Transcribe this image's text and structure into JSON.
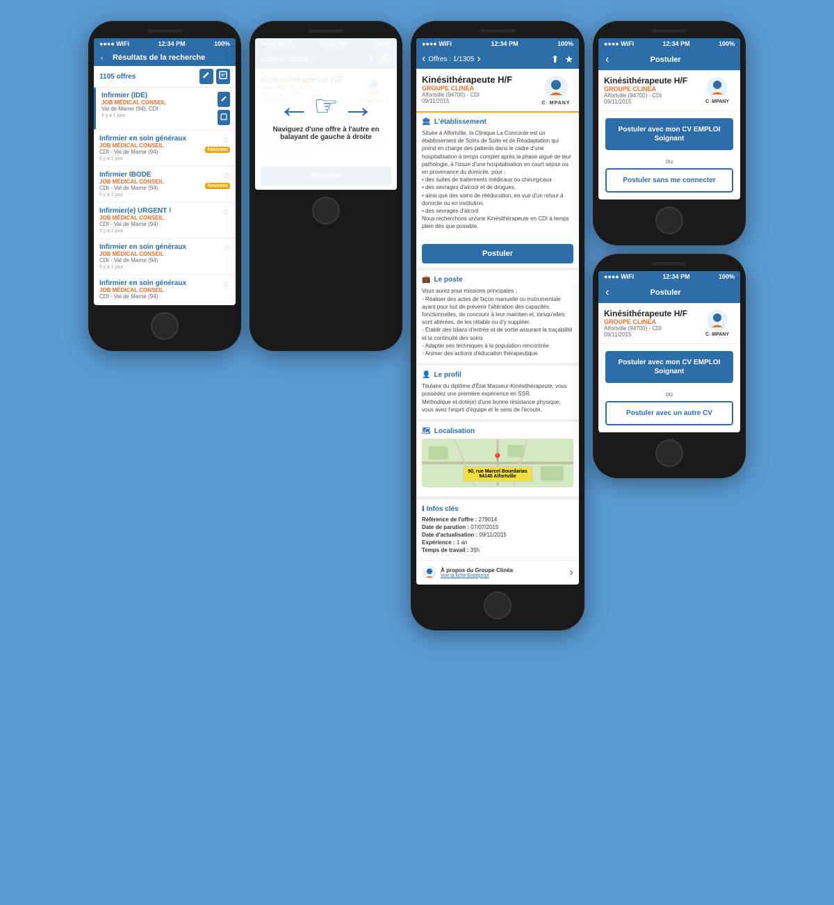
{
  "screen1": {
    "status": {
      "time": "12:34 PM",
      "signal": "●●●●",
      "wifi": "WiFi",
      "battery": "100%"
    },
    "nav": {
      "title": "Résultats de la recherche",
      "back": "‹"
    },
    "count": "1105 offres",
    "results": [
      {
        "title": "Infirmier (IDE)",
        "company": "JOB MÉDICAL CONSEIL",
        "location": "Val de Marne (94), CDI",
        "date": "Il y a 1 jour",
        "badge": "",
        "active": true
      },
      {
        "title": "Infirmier en soin généraux",
        "company": "JOB MÉDICAL CONSEIL",
        "location": "CDI - Val de Marne (94)",
        "date": "Il y a 1 jour",
        "badge": "Nouveau",
        "active": false
      },
      {
        "title": "Infirmier IBODE",
        "company": "JOB MÉDICAL CONSEIL",
        "location": "CDI - Val de Marne (94)",
        "date": "Il y a 1 jour",
        "badge": "Nouveau",
        "active": false
      },
      {
        "title": "Infirmier(e) URGENT !",
        "company": "JOB MÉDICAL CONSEIL",
        "location": "CDI - Val de Marne (94)",
        "date": "Il y a 1 jour",
        "badge": "",
        "active": false
      },
      {
        "title": "Infirmier en soin généraux",
        "company": "JOB MÉDICAL CONSEIL",
        "location": "CDI - Val de Marne (94)",
        "date": "Il y a 1 jour",
        "badge": "",
        "active": false
      },
      {
        "title": "Infirmier en soin généraux",
        "company": "JOB MÉDICAL CONSEIL",
        "location": "CDI - Val de Marne (94)",
        "date": "",
        "badge": "",
        "active": false
      }
    ]
  },
  "screen2": {
    "status": {
      "time": "12:34 PM",
      "signal": "●●●●",
      "wifi": "WiFi",
      "battery": "100%"
    },
    "nav": {
      "back": "‹ Offres :",
      "counter": "1/1305",
      "forward": "›",
      "share": "⬆",
      "close": "✕"
    },
    "offer": {
      "title": "Kinésithérapeute H/F",
      "company": "GROUPE CLINÉA",
      "location": "Alfortville (94700) - CDI",
      "date": "09/11/2015",
      "company_logo": "COMPANY"
    },
    "swipe_text": "Naviguez d'une offre à l'autre en balayant de gauche à droite",
    "postuler": "Postuler"
  },
  "screen3": {
    "status": {
      "time": "12:34 PM",
      "signal": "●●●●",
      "wifi": "WiFi",
      "battery": "100%"
    },
    "nav": {
      "back": "‹",
      "counter": "Offres : 1/1305",
      "forward": "›",
      "share": "⬆",
      "star": "★"
    },
    "offer": {
      "title": "Kinésithérapeute H/F",
      "company": "GROUPE CLINÉA",
      "location": "Alfortville (94700) - CDI",
      "date": "09/11/2015",
      "company_logo": "COMPANY"
    },
    "sections": {
      "etablissement": {
        "title": "L'établissement",
        "text": "Située à Alfortville, la Clinique La Concorde est un établissement de Soins de Suite et de Réadaptation qui prend en charge des patients dans le cadre d'une hospitalisation à temps complet après la phase aiguë de leur pathologie, à l'issue d'une hospitalisation en court séjour ou en provenance du domicile, pour :\n• des suites de traitements médicaux ou chirurgicaux\n• des sevrages d'alcool et de drogues,\n• ainsi que des soins de rééducation, en vue d'un retour à domicile ou en institution,\n• des sevrages d'alcool\nNous recherchons un/une Kinésithérapeute en CDI à temps plein dès que possible."
      },
      "poste": {
        "title": "Le poste",
        "text": "Vous aurez pour missions principales :\n- Réaliser des actes de façon manuelle ou instrumentale ayant pour but de prévenir l'altération des capacités fonctionnelles, de concourir à leur maintien et, lorsqu'elles sont altérées, de les rétablir ou d'y suppléer.\n- Établir des bilans d'entrée et de sortie assurant la traçabilité et la continuité des soins\n- Adapter ses techniques à la population rencontrée\n- Animer des actions d'éducation thérapeutique"
      },
      "profil": {
        "title": "Le profil",
        "text": "Titulaire du diplôme d'État Masseur-Kinésithérapeute, vous possédez une première expérience en SSR.\nMéthodique et doté(e) d'une bonne résistance physique, vous avez l'esprit d'équipe et le sens de l'écoute."
      },
      "localisation": {
        "title": "Localisation",
        "address": "90, rue Marcel Bourdarias",
        "city": "94140 Alfortville"
      },
      "infos": {
        "title": "Infos clés",
        "reference": "279014",
        "date_parution": "07/07/2015",
        "date_actualisation": "09/11/2015",
        "experience": "1 an",
        "temps_travail": "35h"
      }
    },
    "company_footer": {
      "title": "À propos du Groupe Clinéa",
      "link": "Voir la fiche Entreprise"
    },
    "postuler": "Postuler"
  },
  "screen4": {
    "status": {
      "time": "12:34 PM",
      "signal": "●●●●",
      "wifi": "WiFi",
      "battery": "100%"
    },
    "nav": {
      "back": "‹",
      "title": "Postuler"
    },
    "offer": {
      "title": "Kinésithérapeute H/F",
      "company": "GROUPE CLINÉA",
      "location": "Alfortville (94700) - CDI",
      "date": "09/11/2015",
      "company_logo": "COMPANY"
    },
    "btn_primary": "Postuler avec mon CV EMPLOI Soignant",
    "separator": "ou",
    "btn_secondary": "Postuler sans me connecter"
  },
  "screen5": {
    "status": {
      "time": "12:34 PM",
      "signal": "●●●●",
      "wifi": "WiFi",
      "battery": "100%"
    },
    "nav": {
      "back": "‹",
      "title": "Postuler"
    },
    "offer": {
      "title": "Kinésithérapeute H/F",
      "company": "GROUPE CLINÉA",
      "location": "Alfortville (94700) - CDI",
      "date": "09/11/2015",
      "company_logo": "COMPANY"
    },
    "btn_primary": "Postuler avec mon CV EMPLOI Soignant",
    "separator": "ou",
    "btn_secondary": "Postuler avec un autre CV"
  },
  "labels": {
    "infos_cles": {
      "reference": "Référence de l'offre :",
      "date_parution": "Date de parution :",
      "date_actualisation": "Date d'actualisation :",
      "experience": "Expérience :",
      "temps_travail": "Temps de travail :"
    }
  }
}
